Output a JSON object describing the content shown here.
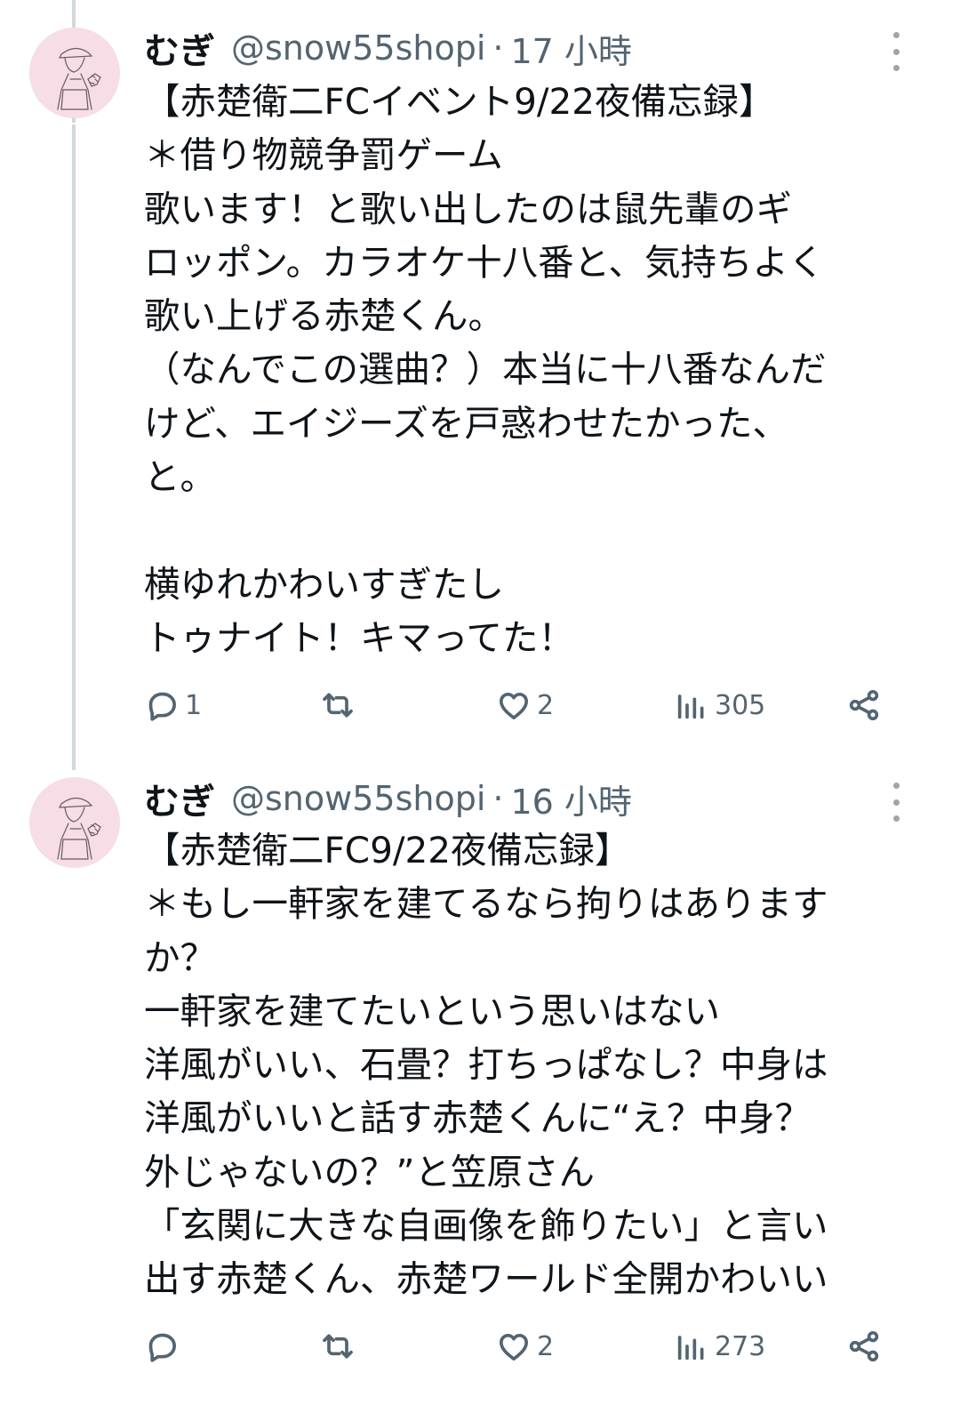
{
  "tweets": [
    {
      "name": "むぎ",
      "handle": "@snow55shopi",
      "separator": "·",
      "time": "17 小時",
      "lines": [
        "【赤楚衛二FCイベント9/22夜備忘録】",
        "＊借り物競争罰ゲーム",
        "歌います！と歌い出したのは鼠先輩のギ",
        "ロッポン。カラオケ十八番と、気持ちよく",
        "歌い上げる赤楚くん。",
        "（なんでこの選曲？）本当に十八番なんだ",
        "けど、エイジーズを戸惑わせたかった、",
        "と。",
        "",
        "横ゆれかわいすぎたし",
        "トゥナイト！キマってた！"
      ],
      "actions": {
        "reply": "1",
        "repost": "",
        "like": "2",
        "views": "305"
      },
      "icons": {
        "reply": "reply-icon",
        "repost": "repost-icon",
        "like": "heart-icon",
        "views": "views-icon",
        "share": "share-icon",
        "more": "more-icon"
      }
    },
    {
      "name": "むぎ",
      "handle": "@snow55shopi",
      "separator": "·",
      "time": "16 小時",
      "lines": [
        "【赤楚衛二FC9/22夜備忘録】",
        "＊もし一軒家を建てるなら拘りはあります",
        "か？",
        "一軒家を建てたいという思いはない",
        "洋風がいい、石畳？打ちっぱなし？中身は",
        "洋風がいいと話す赤楚くんに“え？中身？",
        "外じゃないの？”と笠原さん",
        "「玄関に大きな自画像を飾りたい」と言い",
        "出す赤楚くん、赤楚ワールド全開かわいい"
      ],
      "actions": {
        "reply": "",
        "repost": "",
        "like": "2",
        "views": "273"
      },
      "icons": {
        "reply": "reply-icon",
        "repost": "repost-icon",
        "like": "heart-icon",
        "views": "views-icon",
        "share": "share-icon",
        "more": "more-icon"
      }
    }
  ],
  "colors": {
    "text": "#0f1419",
    "secondary": "#536471",
    "thread_line": "#cfd9de",
    "avatar_bg": "#f6dde6"
  }
}
